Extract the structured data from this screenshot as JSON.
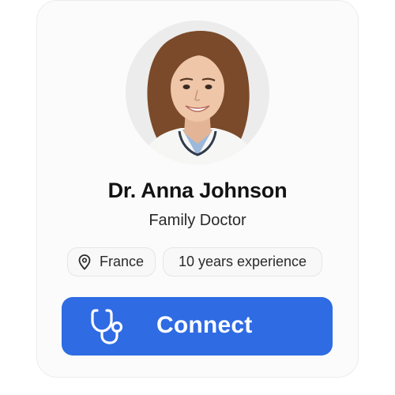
{
  "profile": {
    "name": "Dr. Anna Johnson",
    "role": "Family Doctor",
    "avatar": "doctor-portrait-photo"
  },
  "tags": {
    "location": "France",
    "location_icon": "map-pin-icon",
    "experience": "10 years experience"
  },
  "action": {
    "connect_label": "Connect",
    "connect_icon": "stethoscope-icon"
  },
  "colors": {
    "accent": "#2f6be3",
    "card_background": "#fbfbfb",
    "chip_background": "#f8f8f8",
    "text_primary": "#121212"
  }
}
